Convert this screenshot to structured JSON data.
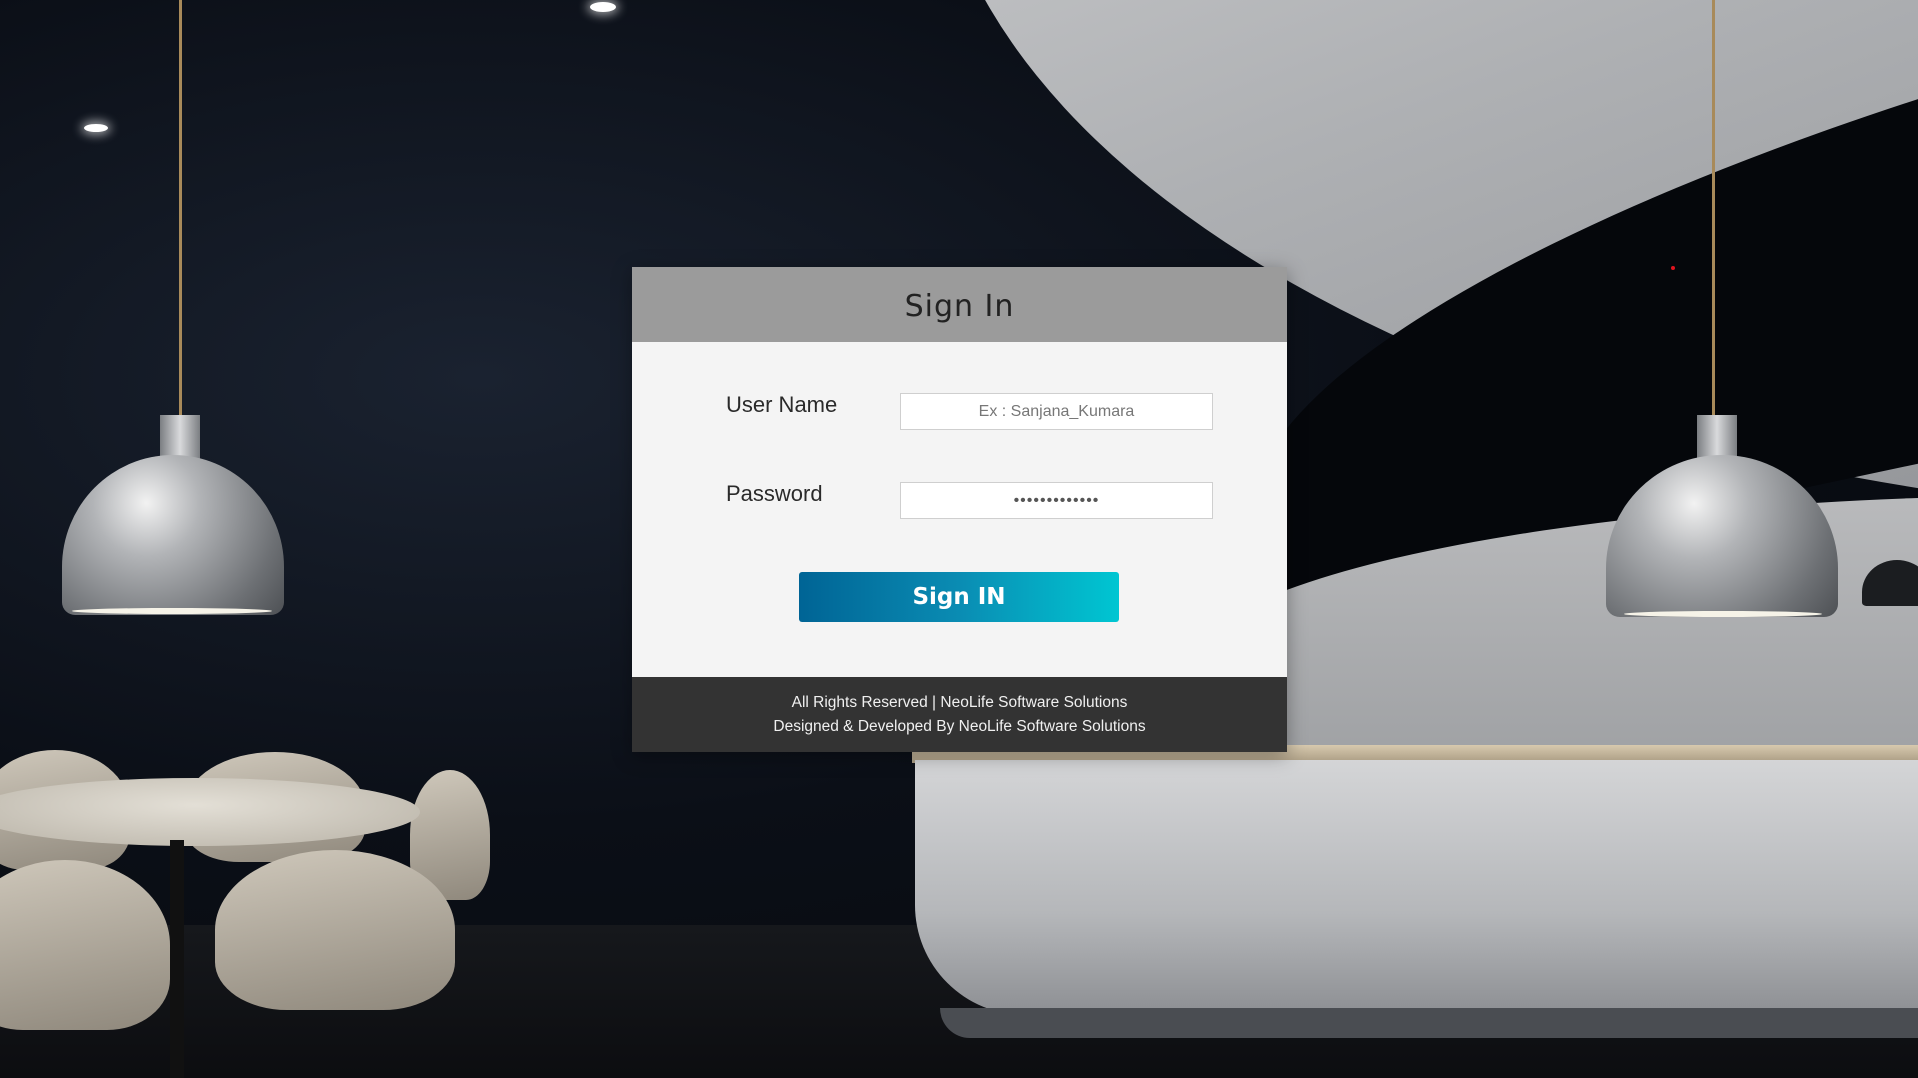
{
  "signin": {
    "title": "Sign In",
    "username_label": "User Name",
    "username_placeholder": "Ex : Sanjana_Kumara",
    "username_value": "",
    "password_label": "Password",
    "password_value": "•••••••••••••",
    "button_label": "Sign IN"
  },
  "footer": {
    "rights": "All Rights Reserved | NeoLife Software Solutions",
    "credits": "Designed & Developed By NeoLife Software Solutions"
  },
  "colors": {
    "header_bg": "#9b9b9b",
    "body_bg": "#f4f4f4",
    "footer_bg": "#333333",
    "button_gradient_start": "#006495",
    "button_gradient_end": "#00c6d2"
  }
}
